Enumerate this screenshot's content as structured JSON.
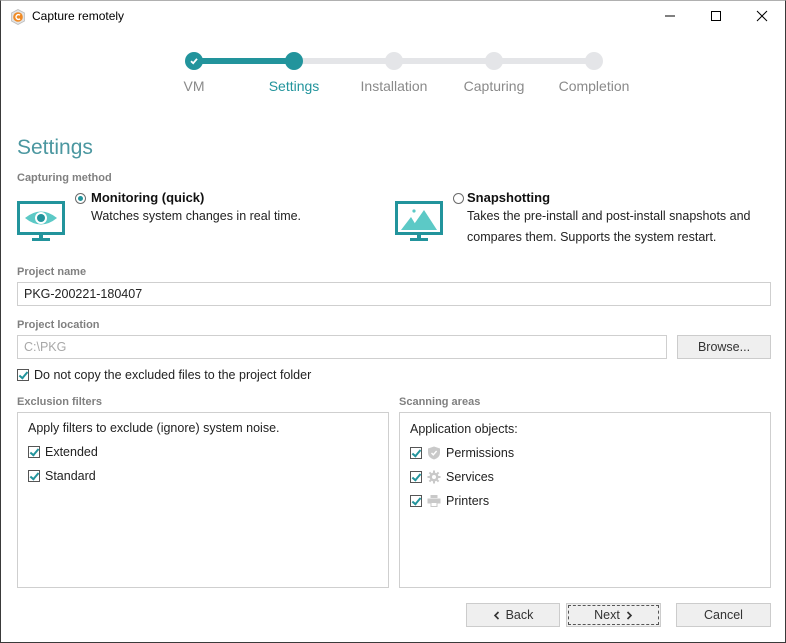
{
  "window": {
    "title": "Capture remotely",
    "controls": {
      "minimize": "minimize",
      "maximize": "maximize",
      "close": "close"
    }
  },
  "stepper": {
    "steps": [
      {
        "label": "VM",
        "state": "done"
      },
      {
        "label": "Settings",
        "state": "active"
      },
      {
        "label": "Installation",
        "state": "pending"
      },
      {
        "label": "Capturing",
        "state": "pending"
      },
      {
        "label": "Completion",
        "state": "pending"
      }
    ]
  },
  "page": {
    "heading": "Settings",
    "capturing_method": {
      "label": "Capturing method",
      "options": [
        {
          "name": "Monitoring (quick)",
          "description": "Watches system changes in real time.",
          "selected": true,
          "icon": "monitor-eye-icon"
        },
        {
          "name": "Snapshotting",
          "description": "Takes the pre-install and post-install snapshots and compares them. Supports the system restart.",
          "selected": false,
          "icon": "monitor-image-icon"
        }
      ]
    },
    "project_name": {
      "label": "Project name",
      "value": "PKG-200221-180407"
    },
    "project_location": {
      "label": "Project location",
      "value": "C:\\PKG",
      "browse_label": "Browse..."
    },
    "no_copy_excluded": {
      "label": "Do not copy the excluded files to the project folder",
      "checked": true
    },
    "exclusion_filters": {
      "label": "Exclusion filters",
      "intro": "Apply filters to exclude (ignore) system noise.",
      "items": [
        {
          "label": "Extended",
          "checked": true
        },
        {
          "label": "Standard",
          "checked": true
        }
      ]
    },
    "scanning_areas": {
      "label": "Scanning areas",
      "intro": "Application objects:",
      "items": [
        {
          "label": "Permissions",
          "checked": true,
          "icon": "shield-icon"
        },
        {
          "label": "Services",
          "checked": true,
          "icon": "gear-icon"
        },
        {
          "label": "Printers",
          "checked": true,
          "icon": "printer-icon"
        }
      ]
    }
  },
  "footer": {
    "back_label": "Back",
    "next_label": "Next",
    "cancel_label": "Cancel"
  },
  "colors": {
    "accent": "#22949c",
    "heading": "#4b97a0",
    "inactive": "#e4e5e8"
  }
}
